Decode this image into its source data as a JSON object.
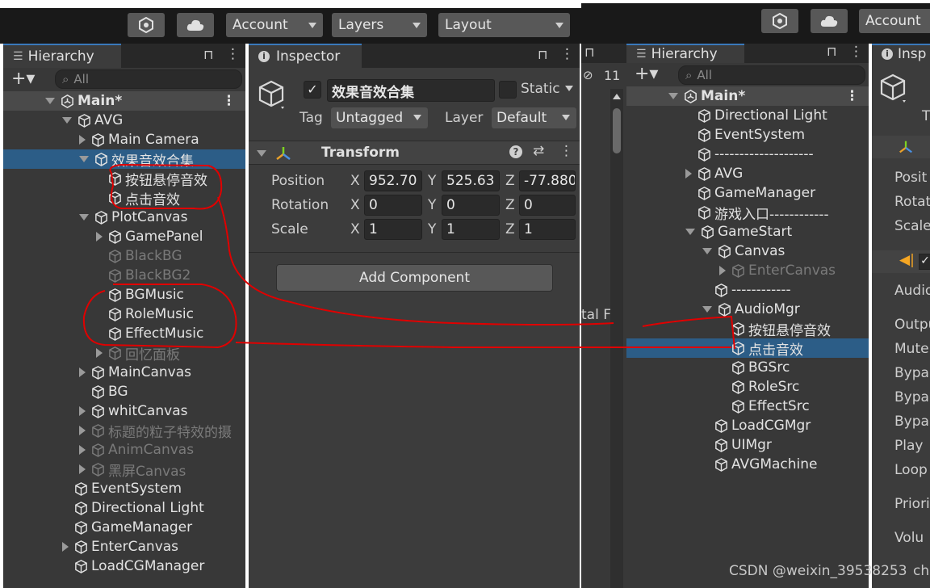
{
  "toolbar_left": {
    "account": "Account",
    "layers": "Layers",
    "layout": "Layout"
  },
  "toolbar_right": {
    "account": "Account"
  },
  "hierarchy_left": {
    "tab": "Hierarchy",
    "search_placeholder": "All",
    "rows": [
      {
        "label": "Main*",
        "level": 0,
        "fold": "open",
        "icon": "unity-logo-icon",
        "state": "scene"
      },
      {
        "label": "AVG",
        "level": 1,
        "fold": "open",
        "icon": "cube-icon",
        "state": "normal"
      },
      {
        "label": "Main Camera",
        "level": 2,
        "fold": "closed",
        "icon": "cube-icon",
        "state": "normal"
      },
      {
        "label": "效果音效合集",
        "level": 2,
        "fold": "open",
        "icon": "cube-icon",
        "state": "selected"
      },
      {
        "label": "按钮悬停音效",
        "level": 3,
        "fold": "",
        "icon": "cube-icon",
        "state": "normal"
      },
      {
        "label": "点击音效",
        "level": 3,
        "fold": "",
        "icon": "cube-icon",
        "state": "normal"
      },
      {
        "label": "PlotCanvas",
        "level": 2,
        "fold": "open",
        "icon": "cube-icon",
        "state": "normal"
      },
      {
        "label": "GamePanel",
        "level": 3,
        "fold": "closed",
        "icon": "cube-icon",
        "state": "normal"
      },
      {
        "label": "BlackBG",
        "level": 3,
        "fold": "",
        "icon": "cube-icon",
        "state": "dim"
      },
      {
        "label": "BlackBG2",
        "level": 3,
        "fold": "",
        "icon": "cube-icon",
        "state": "dim"
      },
      {
        "label": "BGMusic",
        "level": 3,
        "fold": "",
        "icon": "cube-icon",
        "state": "normal"
      },
      {
        "label": "RoleMusic",
        "level": 3,
        "fold": "",
        "icon": "cube-icon",
        "state": "normal"
      },
      {
        "label": "EffectMusic",
        "level": 3,
        "fold": "",
        "icon": "cube-icon",
        "state": "normal"
      },
      {
        "label": "回忆面板",
        "level": 3,
        "fold": "closed",
        "icon": "cube-icon",
        "state": "dim"
      },
      {
        "label": "MainCanvas",
        "level": 2,
        "fold": "closed",
        "icon": "cube-icon",
        "state": "normal"
      },
      {
        "label": "BG",
        "level": 2,
        "fold": "",
        "icon": "cube-icon",
        "state": "normal"
      },
      {
        "label": "whitCanvas",
        "level": 2,
        "fold": "closed",
        "icon": "cube-icon",
        "state": "normal"
      },
      {
        "label": "标题的粒子特效的摄",
        "level": 2,
        "fold": "closed",
        "icon": "cube-icon",
        "state": "dim"
      },
      {
        "label": "AnimCanvas",
        "level": 2,
        "fold": "closed",
        "icon": "cube-icon",
        "state": "dim"
      },
      {
        "label": "黑屏Canvas",
        "level": 2,
        "fold": "closed",
        "icon": "cube-icon",
        "state": "dim"
      },
      {
        "label": "EventSystem",
        "level": 1,
        "fold": "",
        "icon": "cube-icon",
        "state": "normal"
      },
      {
        "label": "Directional Light",
        "level": 1,
        "fold": "",
        "icon": "cube-icon",
        "state": "normal"
      },
      {
        "label": "GameManager",
        "level": 1,
        "fold": "",
        "icon": "cube-icon",
        "state": "normal"
      },
      {
        "label": "EnterCanvas",
        "level": 1,
        "fold": "closed",
        "icon": "cube-icon",
        "state": "normal"
      },
      {
        "label": "LoadCGManager",
        "level": 1,
        "fold": "",
        "icon": "cube-icon",
        "state": "normal"
      }
    ]
  },
  "inspector": {
    "tab": "Inspector",
    "object_name": "效果音效合集",
    "static_label": "Static",
    "tag_label": "Tag",
    "tag_value": "Untagged",
    "layer_label": "Layer",
    "layer_value": "Default",
    "transform_title": "Transform",
    "position_label": "Position",
    "rotation_label": "Rotation",
    "scale_label": "Scale",
    "x": "X",
    "y": "Y",
    "z": "Z",
    "pos": [
      "952.70",
      "525.63",
      "-77.880"
    ],
    "rot": [
      "0",
      "0",
      "0"
    ],
    "scl": [
      "1",
      "1",
      "1"
    ],
    "add_component": "Add Component"
  },
  "middle_strip": {
    "badge": "11",
    "cut_text": "tal F"
  },
  "hierarchy_right": {
    "tab": "Hierarchy",
    "search_placeholder": "All",
    "rows": [
      {
        "label": "Main*",
        "level": 0,
        "fold": "open",
        "icon": "unity-logo-icon",
        "state": "scene"
      },
      {
        "label": "Directional Light",
        "level": 1,
        "fold": "",
        "icon": "cube-icon",
        "state": "normal"
      },
      {
        "label": "EventSystem",
        "level": 1,
        "fold": "",
        "icon": "cube-icon",
        "state": "normal"
      },
      {
        "label": "--------------------",
        "level": 1,
        "fold": "",
        "icon": "cube-icon",
        "state": "normal"
      },
      {
        "label": "AVG",
        "level": 1,
        "fold": "closed",
        "icon": "cube-icon",
        "state": "normal"
      },
      {
        "label": "GameManager",
        "level": 1,
        "fold": "",
        "icon": "cube-icon",
        "state": "normal"
      },
      {
        "label": "游戏入口------------",
        "level": 1,
        "fold": "",
        "icon": "cube-icon",
        "state": "normal"
      },
      {
        "label": "GameStart",
        "level": 1,
        "fold": "open",
        "icon": "cube-icon",
        "state": "normal"
      },
      {
        "label": "Canvas",
        "level": 2,
        "fold": "open",
        "icon": "cube-icon",
        "state": "normal"
      },
      {
        "label": "EnterCanvas",
        "level": 3,
        "fold": "closed",
        "icon": "cube-icon",
        "state": "dim"
      },
      {
        "label": "------------",
        "level": 2,
        "fold": "",
        "icon": "cube-icon",
        "state": "normal"
      },
      {
        "label": "AudioMgr",
        "level": 2,
        "fold": "open",
        "icon": "cube-icon",
        "state": "normal"
      },
      {
        "label": "按钮悬停音效",
        "level": 3,
        "fold": "",
        "icon": "cube-icon",
        "state": "normal"
      },
      {
        "label": "点击音效",
        "level": 3,
        "fold": "",
        "icon": "cube-icon",
        "state": "selected"
      },
      {
        "label": "BGSrc",
        "level": 3,
        "fold": "",
        "icon": "cube-icon",
        "state": "normal"
      },
      {
        "label": "RoleSrc",
        "level": 3,
        "fold": "",
        "icon": "cube-icon",
        "state": "normal"
      },
      {
        "label": "EffectSrc",
        "level": 3,
        "fold": "",
        "icon": "cube-icon",
        "state": "normal"
      },
      {
        "label": "LoadCGMgr",
        "level": 2,
        "fold": "",
        "icon": "cube-icon",
        "state": "normal"
      },
      {
        "label": "UIMgr",
        "level": 2,
        "fold": "",
        "icon": "cube-icon",
        "state": "normal"
      },
      {
        "label": "AVGMachine",
        "level": 2,
        "fold": "",
        "icon": "cube-icon",
        "state": "normal"
      }
    ]
  },
  "inspector_right": {
    "tab": "Insp",
    "labels": [
      "T",
      "Posit",
      "Rotat",
      "Scale",
      "Audio",
      "Outpu",
      "Mute",
      "Bypa",
      "Bypa",
      "Bypa",
      "Play",
      "Loop",
      "Priori",
      "Volu"
    ]
  },
  "watermark": "CSDN @weixin_39538253",
  "watermark_overlap": "ch",
  "colors": {
    "panel": "#383838",
    "toolbar": "#191919",
    "selection": "#2c5d87",
    "annotation": "#e00000",
    "accent": "#3a79bb"
  }
}
